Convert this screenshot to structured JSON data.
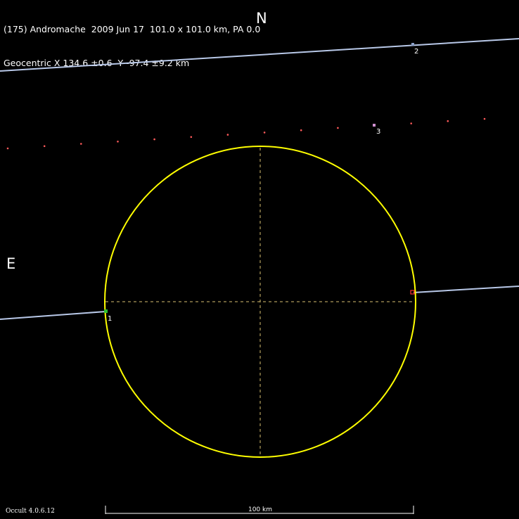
{
  "header": {
    "line1": "(175) Andromache  2009 Jun 17  101.0 x 101.0 km, PA 0.0",
    "line2": "Geocentric X 134.6 ±0.6  Y -97.4 ±9.2 km"
  },
  "compass": {
    "north": "N",
    "east": "E"
  },
  "chords": [
    {
      "label": "1"
    },
    {
      "label": "2"
    },
    {
      "label": "3"
    }
  ],
  "scale_bar": {
    "label": "100 km"
  },
  "footer": {
    "version": "Occult 4.0.6.12"
  },
  "colors": {
    "background": "#000000",
    "limb": "#ffff00",
    "chord": "#b8c8e8",
    "dots": "#ff5a5a",
    "text": "#ffffff"
  }
}
